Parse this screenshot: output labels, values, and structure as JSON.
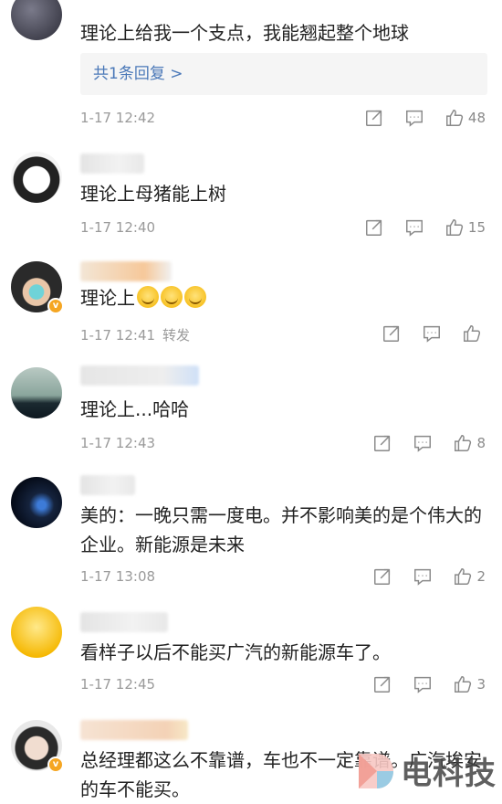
{
  "comments": [
    {
      "content": "理论上给我一个支点，我能翘起整个地球",
      "reply": "共1条回复 >",
      "time": "1-17 12:42",
      "forward": "",
      "likes": "48"
    },
    {
      "content": "理论上母猪能上树",
      "time": "1-17 12:40",
      "forward": "",
      "likes": "15"
    },
    {
      "content": "理论上",
      "emoji_count": 3,
      "time": "1-17 12:41",
      "forward": "转发",
      "likes": ""
    },
    {
      "content": "理论上...哈哈",
      "time": "1-17 12:43",
      "forward": "",
      "likes": "8"
    },
    {
      "content": "美的：一晚只需一度电。并不影响美的是个伟大的企业。新能源是未来",
      "time": "1-17 13:08",
      "forward": "",
      "likes": "2"
    },
    {
      "content": "看样子以后不能买广汽的新能源车了。",
      "time": "1-17 12:45",
      "forward": "",
      "likes": "3"
    },
    {
      "content": "总经理都这么不靠谱，车也不一定靠谱。广汽埃安的车不能买。",
      "time": "",
      "forward": "",
      "likes": ""
    }
  ],
  "watermark": {
    "text": "电科技"
  },
  "icons": {
    "forward": "forward-icon",
    "comment": "comment-icon",
    "like": "thumbs-up-icon"
  }
}
